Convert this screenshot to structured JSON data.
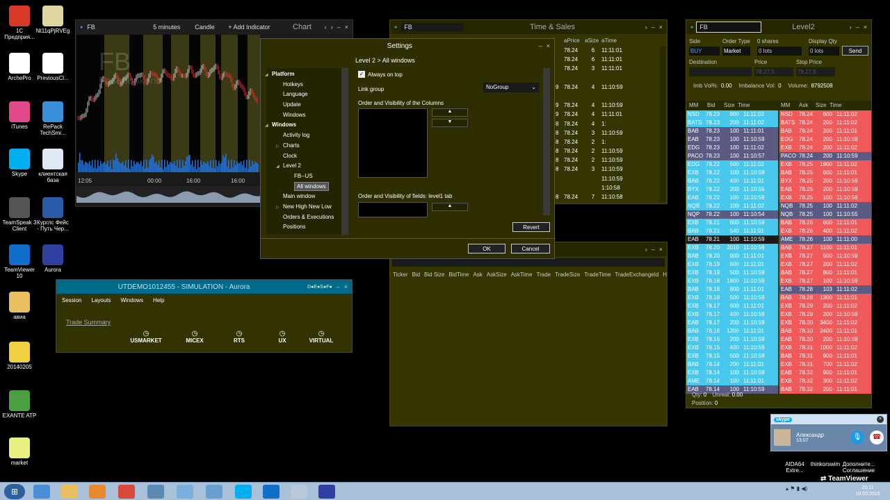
{
  "desktop": {
    "icons": [
      {
        "label": "1С\nПредприя..."
      },
      {
        "label": "Nt11qPjRVEg"
      },
      {
        "label": "ArchePro"
      },
      {
        "label": "PreviousCl..."
      },
      {
        "label": "iTunes"
      },
      {
        "label": "RePack\nTechSmi..."
      },
      {
        "label": "Skype"
      },
      {
        "label": "клиентская\nбаза"
      },
      {
        "label": "TeamSpeak 3\nClient"
      },
      {
        "label": "Курглс Фейс\n- Путь Чер..."
      },
      {
        "label": "TeamViewer\n10"
      },
      {
        "label": "Aurora"
      },
      {
        "label": "авиа"
      },
      {
        "label": "20140205"
      },
      {
        "label": "EXANTE ATP"
      },
      {
        "label": "market"
      }
    ],
    "tray_icons": [
      {
        "label": "AIDA64\nExtre..."
      },
      {
        "label": "thinkorswim"
      },
      {
        "label": "Дополните...\nСоглашение"
      }
    ]
  },
  "chart_window": {
    "symbol": "FB",
    "interval": "5 minutes",
    "type": "Candle",
    "add_indicator": "+ Add Indicator",
    "title": "Chart",
    "watermark_symbol": "FB",
    "watermark_name": "Facebook Inc",
    "time_labels": [
      "12:05",
      "00:00",
      "16:00",
      "16:00"
    ]
  },
  "aurora_window": {
    "title": "UTDEMO1012455 - SIMULATION - Aurora",
    "menu": [
      "Session",
      "Layouts",
      "Windows",
      "Help"
    ],
    "trade_summary": "Trade Summary",
    "markets": [
      "USMARKET",
      "MICEX",
      "RTS",
      "UX",
      "VIRTUAL"
    ]
  },
  "time_sales": {
    "symbol": "FB",
    "title": "Time & Sales",
    "headers": [
      "aPrice",
      "aSize",
      "aTime"
    ],
    "rows": [
      {
        "n": "",
        "p": "78.24",
        "s": "6",
        "t": "11:11:01"
      },
      {
        "n": "",
        "p": "78.24",
        "s": "6",
        "t": "11:11:01"
      },
      {
        "n": "",
        "p": "78.24",
        "s": "3",
        "t": "11:11:01"
      },
      {
        "n": "",
        "p": "",
        "s": "",
        "t": ""
      },
      {
        "n": "9",
        "p": "78.24",
        "s": "4",
        "t": "11:10:59"
      },
      {
        "n": "",
        "p": "",
        "s": "",
        "t": ""
      },
      {
        "n": "9",
        "p": "78.24",
        "s": "4",
        "t": "11:10:59"
      },
      {
        "n": "9",
        "p": "78.24",
        "s": "4",
        "t": "11:11:01"
      },
      {
        "n": "8",
        "p": "78.24",
        "s": "4",
        "t": "1:"
      },
      {
        "n": "8",
        "p": "78.24",
        "s": "3",
        "t": "11:10:59"
      },
      {
        "n": "8",
        "p": "78.24",
        "s": "2",
        "t": "1:"
      },
      {
        "n": "8",
        "p": "78.24",
        "s": "2",
        "t": "11:10:59"
      },
      {
        "n": "8",
        "p": "78.24",
        "s": "2",
        "t": "11:10:59"
      },
      {
        "n": "8",
        "p": "78.24",
        "s": "3",
        "t": "11:10:59"
      },
      {
        "n": "",
        "p": "",
        "s": "",
        "t": "11:10:59"
      },
      {
        "n": "",
        "p": "",
        "s": "",
        "t": "1:10:58"
      },
      {
        "n": "8",
        "p": "78.24",
        "s": "7",
        "t": "11:10:58"
      }
    ]
  },
  "quotes_window": {
    "columns": [
      "Ticker",
      "Bid",
      "Bid Size",
      "BidTime",
      "Ask",
      "AskSize",
      "AskTime",
      "Trade",
      "TradeSize",
      "TradeTime",
      "TradeExchangeId",
      "Hig"
    ]
  },
  "settings": {
    "title": "Settings",
    "breadcrumb": "Level 2 > All windows",
    "tree": [
      {
        "label": "Platform",
        "level": 0,
        "bold": true,
        "arrow": "◢"
      },
      {
        "label": "Hotkeys",
        "level": 1
      },
      {
        "label": "Language",
        "level": 1
      },
      {
        "label": "Update",
        "level": 1
      },
      {
        "label": "Windows",
        "level": 1
      },
      {
        "label": "Windows",
        "level": 0,
        "bold": true,
        "arrow": "◢"
      },
      {
        "label": "Activity log",
        "level": 1
      },
      {
        "label": "Charts",
        "level": 1,
        "arrow": "▷"
      },
      {
        "label": "Clock",
        "level": 1
      },
      {
        "label": "Level 2",
        "level": 1,
        "arrow": "◢"
      },
      {
        "label": "FB--US",
        "level": 2
      },
      {
        "label": "All windows",
        "level": 2,
        "selected": true
      },
      {
        "label": "Main window",
        "level": 1
      },
      {
        "label": "New High New Low",
        "level": 1,
        "arrow": "▷"
      },
      {
        "label": "Orders & Executions",
        "level": 1
      },
      {
        "label": "Positions",
        "level": 1
      }
    ],
    "always_on_top": "Always on top",
    "link_group_label": "Link group",
    "link_group_value": "NoGroup",
    "columns_label": "Order and Visibility of the Columns",
    "fields_label": "Order and Visibility of fields: level1 tab",
    "revert": "Revert",
    "ok": "OK",
    "cancel": "Cancel"
  },
  "level2": {
    "symbol": "FB",
    "title": "Level2",
    "side_label": "Side",
    "side_value": "BUY",
    "order_type_label": "Order Type",
    "order_type_value": "Market",
    "shares_label": "0 shares",
    "lots_value": "0 lots",
    "display_qty_label": "Display Qty",
    "display_lots": "0 lots",
    "send": "Send",
    "destination_label": "Destination",
    "price_label": "Price",
    "price_value": "78.27.5",
    "stop_price_label": "Stop Price",
    "stop_price_value": "78.27.5",
    "imb_label": "Imb Vol%:",
    "imb_value": "0.00",
    "imbalance_label": "Imbalance Vol:",
    "imbalance_value": "0",
    "volume_label": "Volume:",
    "volume_value": "8792508",
    "bid_headers": [
      "MM",
      "Bid",
      "Size",
      "Time"
    ],
    "ask_headers": [
      "MM",
      "Ask",
      "Size",
      "Time"
    ],
    "bids": [
      {
        "mm": "NSD",
        "p": "78.23",
        "s": "800",
        "t": "11:11:02",
        "c": "#48c8ec"
      },
      {
        "mm": "BATS",
        "p": "78.23",
        "s": "200",
        "t": "11:11:02",
        "c": "#48c8ec"
      },
      {
        "mm": "BAB",
        "p": "78.23",
        "s": "100",
        "t": "11:11:01",
        "c": "#5a5a82"
      },
      {
        "mm": "EAB",
        "p": "78.23",
        "s": "100",
        "t": "11:10:59",
        "c": "#5a5a82"
      },
      {
        "mm": "EDG",
        "p": "78.23",
        "s": "100",
        "t": "11:11:02",
        "c": "#5a5a82"
      },
      {
        "mm": "PACO",
        "p": "78.23",
        "s": "100",
        "t": "11:10:57",
        "c": "#5a5a82"
      },
      {
        "mm": "EDG",
        "p": "78.22",
        "s": "500",
        "t": "11:11:02",
        "c": "#48c8ec"
      },
      {
        "mm": "EXB",
        "p": "78.22",
        "s": "100",
        "t": "11:10:59",
        "c": "#48c8ec"
      },
      {
        "mm": "BAB",
        "p": "78.22",
        "s": "400",
        "t": "11:11:01",
        "c": "#48c8ec"
      },
      {
        "mm": "BYX",
        "p": "78.22",
        "s": "200",
        "t": "11:10:55",
        "c": "#48c8ec"
      },
      {
        "mm": "EAB",
        "p": "78.22",
        "s": "100",
        "t": "11:10:59",
        "c": "#48c8ec"
      },
      {
        "mm": "NQB",
        "p": "78.22",
        "s": "100",
        "t": "11:11:02",
        "c": "#48c8ec"
      },
      {
        "mm": "NQP",
        "p": "78.22",
        "s": "100",
        "t": "11:10:54",
        "c": "#5a5a82"
      },
      {
        "mm": "EXB",
        "p": "78.21",
        "s": "600",
        "t": "11:10:59",
        "c": "#48c8ec"
      },
      {
        "mm": "BAB",
        "p": "78.21",
        "s": "540",
        "t": "11:11:01",
        "c": "#48c8ec"
      },
      {
        "mm": "EAB",
        "p": "78.21",
        "s": "100",
        "t": "11:10:59",
        "c": "#1a1a1a"
      },
      {
        "mm": "EXB",
        "p": "78.20",
        "s": "2010",
        "t": "11:10:59",
        "c": "#48c8ec"
      },
      {
        "mm": "BAB",
        "p": "78.20",
        "s": "900",
        "t": "11:11:01",
        "c": "#48c8ec"
      },
      {
        "mm": "EXB",
        "p": "78.19",
        "s": "600",
        "t": "11:11:01",
        "c": "#48c8ec"
      },
      {
        "mm": "EXB",
        "p": "78.19",
        "s": "500",
        "t": "11:10:59",
        "c": "#48c8ec"
      },
      {
        "mm": "EXB",
        "p": "78.18",
        "s": "1800",
        "t": "11:10:59",
        "c": "#48c8ec"
      },
      {
        "mm": "BAB",
        "p": "78.18",
        "s": "800",
        "t": "11:11:01",
        "c": "#48c8ec"
      },
      {
        "mm": "EXB",
        "p": "78.18",
        "s": "500",
        "t": "11:10:59",
        "c": "#48c8ec"
      },
      {
        "mm": "EXB",
        "p": "78.17",
        "s": "600",
        "t": "11:11:01",
        "c": "#48c8ec"
      },
      {
        "mm": "EXB",
        "p": "78.17",
        "s": "400",
        "t": "11:10:59",
        "c": "#48c8ec"
      },
      {
        "mm": "EAB",
        "p": "78.17",
        "s": "200",
        "t": "11:10:59",
        "c": "#48c8ec"
      },
      {
        "mm": "BAB",
        "p": "78.16",
        "s": "1200",
        "t": "11:11:01",
        "c": "#48c8ec"
      },
      {
        "mm": "EXB",
        "p": "78.16",
        "s": "200",
        "t": "11:10:59",
        "c": "#48c8ec"
      },
      {
        "mm": "EXB",
        "p": "78.15",
        "s": "400",
        "t": "11:10:59",
        "c": "#48c8ec"
      },
      {
        "mm": "EXB",
        "p": "78.15",
        "s": "500",
        "t": "11:10:59",
        "c": "#48c8ec"
      },
      {
        "mm": "BAB",
        "p": "78.14",
        "s": "200",
        "t": "11:11:01",
        "c": "#48c8ec"
      },
      {
        "mm": "EXB",
        "p": "78.14",
        "s": "100",
        "t": "11:10:59",
        "c": "#48c8ec"
      },
      {
        "mm": "AME",
        "p": "78.14",
        "s": "100",
        "t": "11:11:01",
        "c": "#48c8ec"
      },
      {
        "mm": "EAB",
        "p": "78.14",
        "s": "100",
        "t": "11:10:59",
        "c": "#5a5a82"
      }
    ],
    "asks": [
      {
        "mm": "NSD",
        "p": "78.24",
        "s": "600",
        "t": "11:11:02",
        "c": "#f05a5a"
      },
      {
        "mm": "BATS",
        "p": "78.24",
        "s": "200",
        "t": "11:11:02",
        "c": "#f05a5a"
      },
      {
        "mm": "BAB",
        "p": "78.24",
        "s": "200",
        "t": "11:11:01",
        "c": "#f05a5a"
      },
      {
        "mm": "EDG",
        "p": "78.24",
        "s": "200",
        "t": "11:10:59",
        "c": "#f05a5a"
      },
      {
        "mm": "EXB",
        "p": "78.24",
        "s": "200",
        "t": "11:11:02",
        "c": "#f05a5a"
      },
      {
        "mm": "PACO",
        "p": "78.24",
        "s": "200",
        "t": "11:10:59",
        "c": "#5a5a82"
      },
      {
        "mm": "EXB",
        "p": "78.25",
        "s": "1900",
        "t": "11:11:02",
        "c": "#f05a5a"
      },
      {
        "mm": "BAB",
        "p": "78.25",
        "s": "600",
        "t": "11:11:01",
        "c": "#f05a5a"
      },
      {
        "mm": "BYX",
        "p": "78.25",
        "s": "200",
        "t": "11:10:59",
        "c": "#f05a5a"
      },
      {
        "mm": "EAB",
        "p": "78.25",
        "s": "200",
        "t": "11:10:59",
        "c": "#f05a5a"
      },
      {
        "mm": "EXB",
        "p": "78.25",
        "s": "100",
        "t": "11:10:59",
        "c": "#f05a5a"
      },
      {
        "mm": "NQB",
        "p": "78.25",
        "s": "100",
        "t": "11:11:02",
        "c": "#5a5a82"
      },
      {
        "mm": "NQB",
        "p": "78.25",
        "s": "100",
        "t": "11:10:55",
        "c": "#5a5a82"
      },
      {
        "mm": "BAB",
        "p": "78.26",
        "s": "600",
        "t": "11:11:01",
        "c": "#f05a5a"
      },
      {
        "mm": "EXB",
        "p": "78.26",
        "s": "400",
        "t": "11:11:02",
        "c": "#f05a5a"
      },
      {
        "mm": "AME",
        "p": "78.26",
        "s": "100",
        "t": "11:11:00",
        "c": "#5a5a82"
      },
      {
        "mm": "BAB",
        "p": "78.27",
        "s": "1100",
        "t": "11:11:01",
        "c": "#f05a5a"
      },
      {
        "mm": "EXB",
        "p": "78.27",
        "s": "500",
        "t": "11:10:59",
        "c": "#f05a5a"
      },
      {
        "mm": "EXB",
        "p": "78.27",
        "s": "200",
        "t": "11:11:02",
        "c": "#f05a5a"
      },
      {
        "mm": "BAB",
        "p": "78.27",
        "s": "800",
        "t": "11:11:01",
        "c": "#f05a5a"
      },
      {
        "mm": "EXB",
        "p": "78.27",
        "s": "100",
        "t": "11:10:59",
        "c": "#f05a5a"
      },
      {
        "mm": "EAB",
        "p": "78.28",
        "s": "103",
        "t": "11:11:02",
        "c": "#5a5a82"
      },
      {
        "mm": "BAB",
        "p": "78.28",
        "s": "1300",
        "t": "11:11:01",
        "c": "#f05a5a"
      },
      {
        "mm": "EXB",
        "p": "78.29",
        "s": "200",
        "t": "11:11:02",
        "c": "#f05a5a"
      },
      {
        "mm": "EXB",
        "p": "78.29",
        "s": "200",
        "t": "11:10:59",
        "c": "#f05a5a"
      },
      {
        "mm": "EXB",
        "p": "78.30",
        "s": "3400",
        "t": "11:11:02",
        "c": "#f05a5a"
      },
      {
        "mm": "BAB",
        "p": "78.30",
        "s": "2400",
        "t": "11:11:01",
        "c": "#f05a5a"
      },
      {
        "mm": "EAB",
        "p": "78.30",
        "s": "200",
        "t": "11:10:59",
        "c": "#f05a5a"
      },
      {
        "mm": "EXB",
        "p": "78.31",
        "s": "1000",
        "t": "11:11:02",
        "c": "#f05a5a"
      },
      {
        "mm": "BAB",
        "p": "78.31",
        "s": "900",
        "t": "11:11:01",
        "c": "#f05a5a"
      },
      {
        "mm": "EXB",
        "p": "78.31",
        "s": "700",
        "t": "11:11:02",
        "c": "#f05a5a"
      },
      {
        "mm": "EAB",
        "p": "78.32",
        "s": "900",
        "t": "11:11:01",
        "c": "#f05a5a"
      },
      {
        "mm": "EXB",
        "p": "78.32",
        "s": "300",
        "t": "11:11:02",
        "c": "#f05a5a"
      },
      {
        "mm": "BAB",
        "p": "78.32",
        "s": "200",
        "t": "11:11:01",
        "c": "#f05a5a"
      }
    ],
    "qty_label": "Qty:",
    "qty_value": "0",
    "unreal_label": "Unreal:",
    "unreal_value": "0.00",
    "position_label": "Position:",
    "position_value": "0"
  },
  "skype_popup": {
    "app": "skype",
    "caller": "Александр",
    "duration": "13:07"
  },
  "teamviewer_label": "TeamViewer",
  "clock": {
    "time": "20:11",
    "date": "10.03.2015"
  }
}
